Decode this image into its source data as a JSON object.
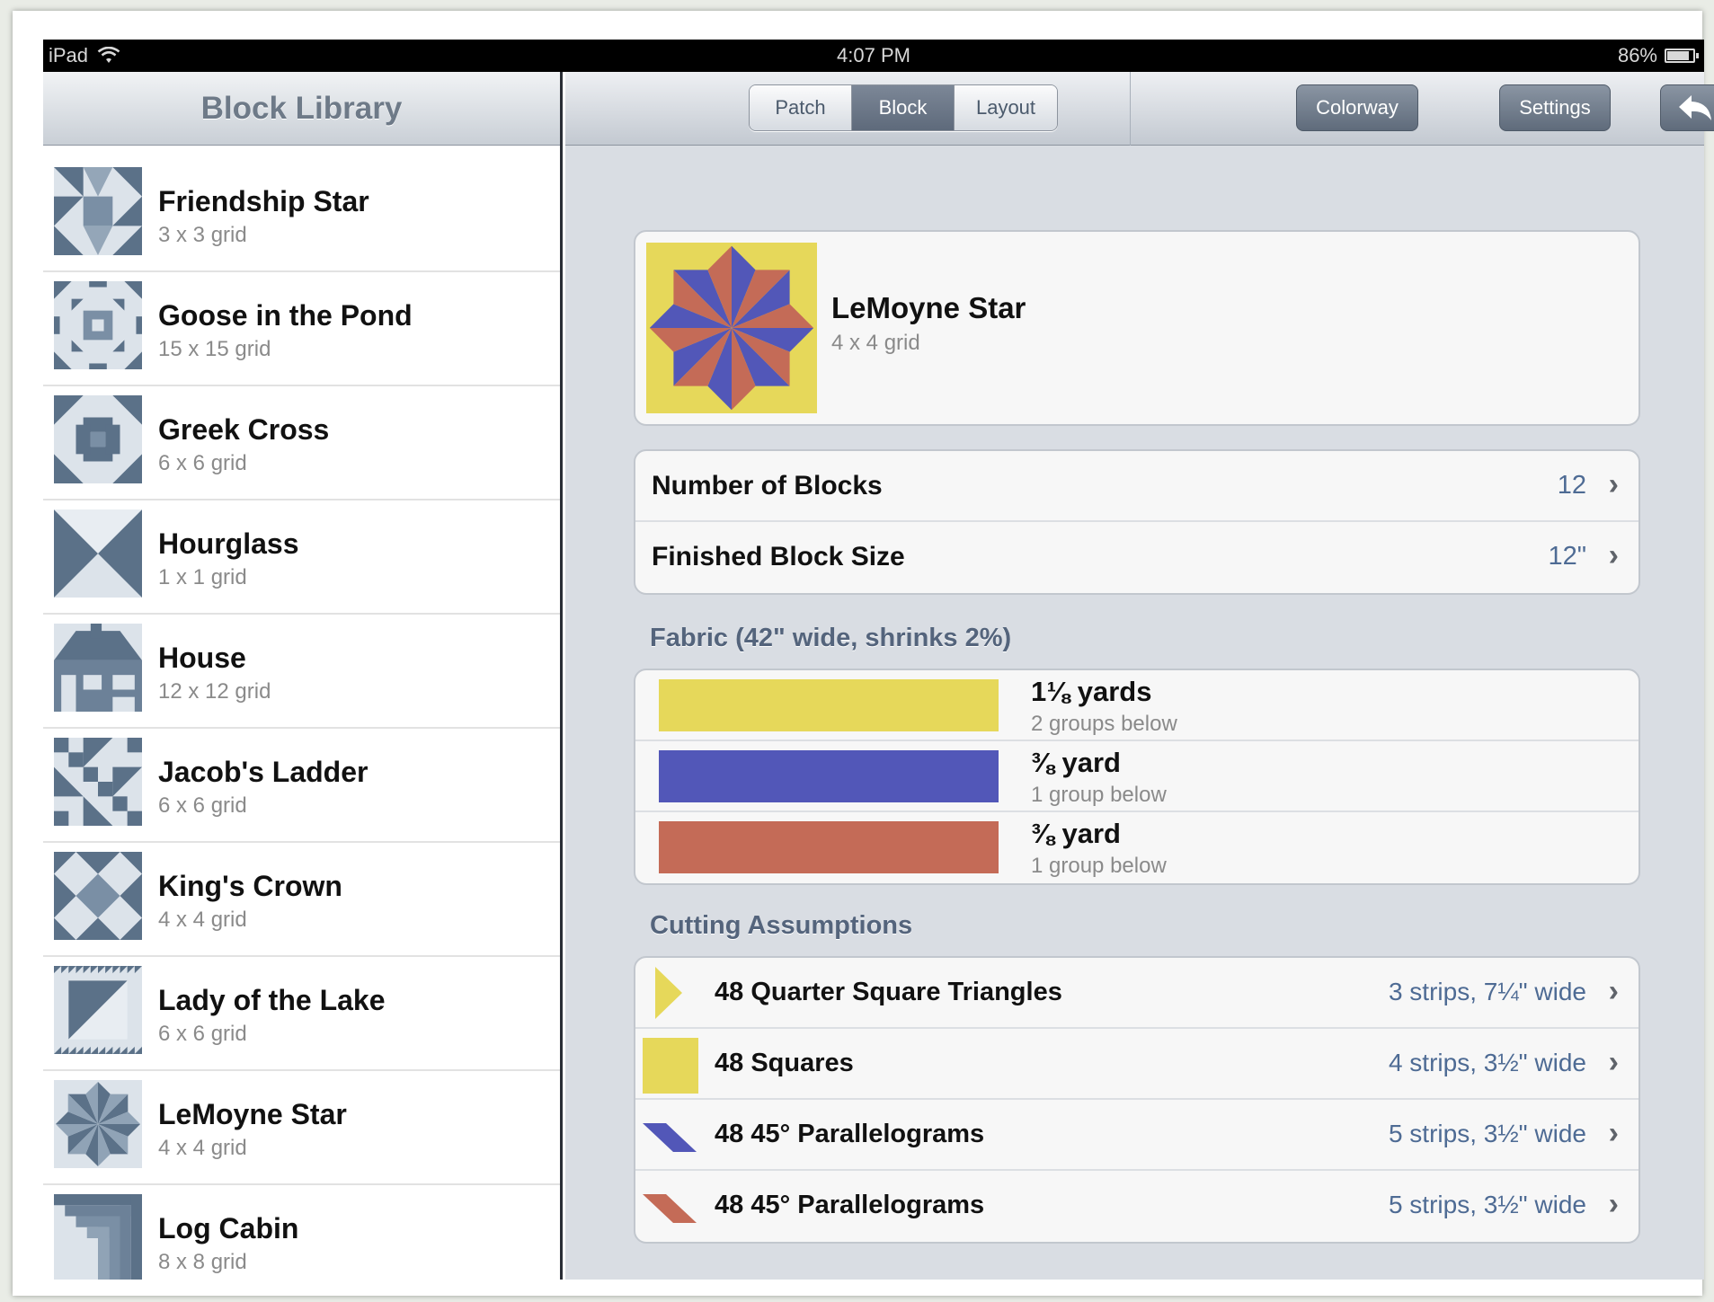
{
  "status_bar": {
    "device": "iPad",
    "time": "4:07 PM",
    "battery": "86%",
    "battery_level": 0.86
  },
  "sidebar": {
    "title": "Block Library",
    "items": [
      {
        "name": "Friendship Star",
        "grid": "3 x 3 grid",
        "icon": "friendship-star-icon"
      },
      {
        "name": "Goose in the Pond",
        "grid": "15 x 15 grid",
        "icon": "goose-in-the-pond-icon"
      },
      {
        "name": "Greek Cross",
        "grid": "6 x 6 grid",
        "icon": "greek-cross-icon"
      },
      {
        "name": "Hourglass",
        "grid": "1 x 1 grid",
        "icon": "hourglass-icon"
      },
      {
        "name": "House",
        "grid": "12 x 12 grid",
        "icon": "house-icon"
      },
      {
        "name": "Jacob's Ladder",
        "grid": "6 x 6 grid",
        "icon": "jacobs-ladder-icon"
      },
      {
        "name": "King's Crown",
        "grid": "4 x 4 grid",
        "icon": "kings-crown-icon"
      },
      {
        "name": "Lady of the Lake",
        "grid": "6 x 6 grid",
        "icon": "lady-of-the-lake-icon"
      },
      {
        "name": "LeMoyne Star",
        "grid": "4 x 4 grid",
        "icon": "lemoyne-star-icon"
      },
      {
        "name": "Log Cabin",
        "grid": "8 x 8 grid",
        "icon": "log-cabin-icon"
      }
    ]
  },
  "toolbar": {
    "tabs": [
      "Patch",
      "Block",
      "Layout"
    ],
    "active_tab": "Block",
    "colorway_label": "Colorway",
    "settings_label": "Settings",
    "back_icon": "back-arrow-icon"
  },
  "block": {
    "name": "LeMoyne Star",
    "grid": "4 x 4 grid"
  },
  "settings_rows": [
    {
      "label": "Number of Blocks",
      "value": "12"
    },
    {
      "label": "Finished Block Size",
      "value": "12\""
    }
  ],
  "fabric": {
    "title": "Fabric (42\" wide, shrinks 2%)",
    "items": [
      {
        "amount": "1⅛ yards",
        "groups": "2 groups below",
        "color": "#e6d85a"
      },
      {
        "amount": "⅜ yard",
        "groups": "1 group below",
        "color": "#5257b8"
      },
      {
        "amount": "⅜ yard",
        "groups": "1 group below",
        "color": "#c46b57"
      }
    ]
  },
  "cutting": {
    "title": "Cutting Assumptions",
    "items": [
      {
        "label": "48 Quarter Square Triangles",
        "value": "3 strips, 7¼\" wide",
        "icon": "triangle-icon",
        "color": "#e6d85a"
      },
      {
        "label": "48 Squares",
        "value": "4 strips, 3½\" wide",
        "icon": "square-icon",
        "color": "#e6d85a"
      },
      {
        "label": "48 45° Parallelograms",
        "value": "5 strips, 3½\" wide",
        "icon": "parallelogram-icon",
        "color": "#5257b8"
      },
      {
        "label": "48 45° Parallelograms",
        "value": "5 strips, 3½\" wide",
        "icon": "parallelogram-icon",
        "color": "#c46b57"
      }
    ]
  },
  "colors": {
    "yellow": "#e6d85a",
    "blue": "#5257b8",
    "red": "#c46b57",
    "thumb": "#5b7188",
    "value_text": "#4e6b94"
  }
}
